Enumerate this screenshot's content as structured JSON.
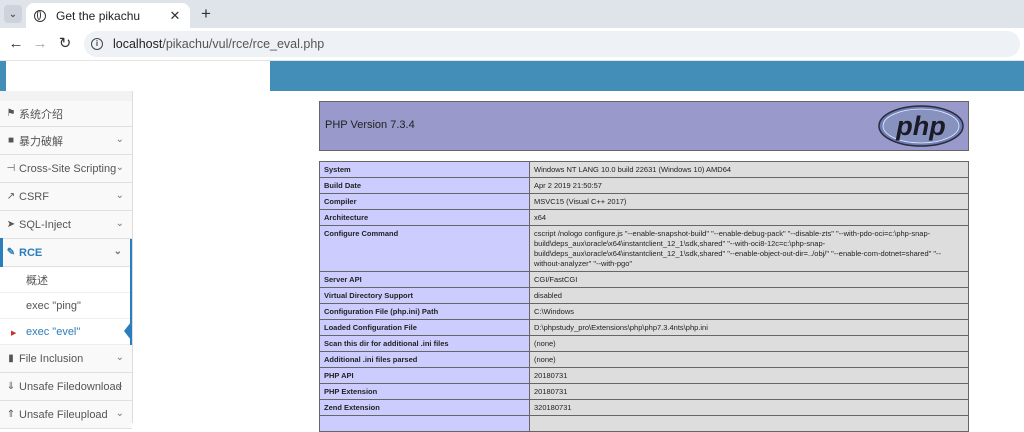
{
  "browser": {
    "tab_title": "Get the pikachu",
    "url_host": "localhost",
    "url_path": "/pikachu/vul/rce/rce_eval.php"
  },
  "sidebar": {
    "items": [
      {
        "label": "系统介绍",
        "icon": "tag-icon"
      },
      {
        "label": "暴力破解",
        "icon": "lock-icon"
      },
      {
        "label": "Cross-Site Scripting",
        "icon": "sitemap-icon"
      },
      {
        "label": "CSRF",
        "icon": "share-icon"
      },
      {
        "label": "SQL-Inject",
        "icon": "fighter-jet-icon"
      },
      {
        "label": "RCE",
        "icon": "pencil-icon"
      },
      {
        "label": "File Inclusion",
        "icon": "file-icon"
      },
      {
        "label": "Unsafe Filedownload",
        "icon": "download-icon"
      },
      {
        "label": "Unsafe Fileupload",
        "icon": "upload-icon"
      }
    ],
    "rce_sub": [
      "概述",
      "exec \"ping\"",
      "exec \"evel\""
    ]
  },
  "phpinfo": {
    "version_title": "PHP Version 7.3.4",
    "logo_text": "php",
    "rows": [
      [
        "System",
        "Windows NT LANG 10.0 build 22631 (Windows 10) AMD64"
      ],
      [
        "Build Date",
        "Apr 2 2019 21:50:57"
      ],
      [
        "Compiler",
        "MSVC15 (Visual C++ 2017)"
      ],
      [
        "Architecture",
        "x64"
      ],
      [
        "Configure Command",
        "cscript /nologo configure.js \"--enable-snapshot-build\" \"--enable-debug-pack\" \"--disable-zts\" \"--with-pdo-oci=c:\\php-snap-build\\deps_aux\\oracle\\x64\\instantclient_12_1\\sdk,shared\" \"--with-oci8-12c=c:\\php-snap-build\\deps_aux\\oracle\\x64\\instantclient_12_1\\sdk,shared\" \"--enable-object-out-dir=../obj/\" \"--enable-com-dotnet=shared\" \"--without-analyzer\" \"--with-pgo\""
      ],
      [
        "Server API",
        "CGI/FastCGI"
      ],
      [
        "Virtual Directory Support",
        "disabled"
      ],
      [
        "Configuration File (php.ini) Path",
        "C:\\Windows"
      ],
      [
        "Loaded Configuration File",
        "D:\\phpstudy_pro\\Extensions\\php\\php7.3.4nts\\php.ini"
      ],
      [
        "Scan this dir for additional .ini files",
        "(none)"
      ],
      [
        "Additional .ini files parsed",
        "(none)"
      ],
      [
        "PHP API",
        "20180731"
      ],
      [
        "PHP Extension",
        "20180731"
      ],
      [
        "Zend Extension",
        "320180731"
      ],
      [
        "",
        ""
      ]
    ]
  }
}
